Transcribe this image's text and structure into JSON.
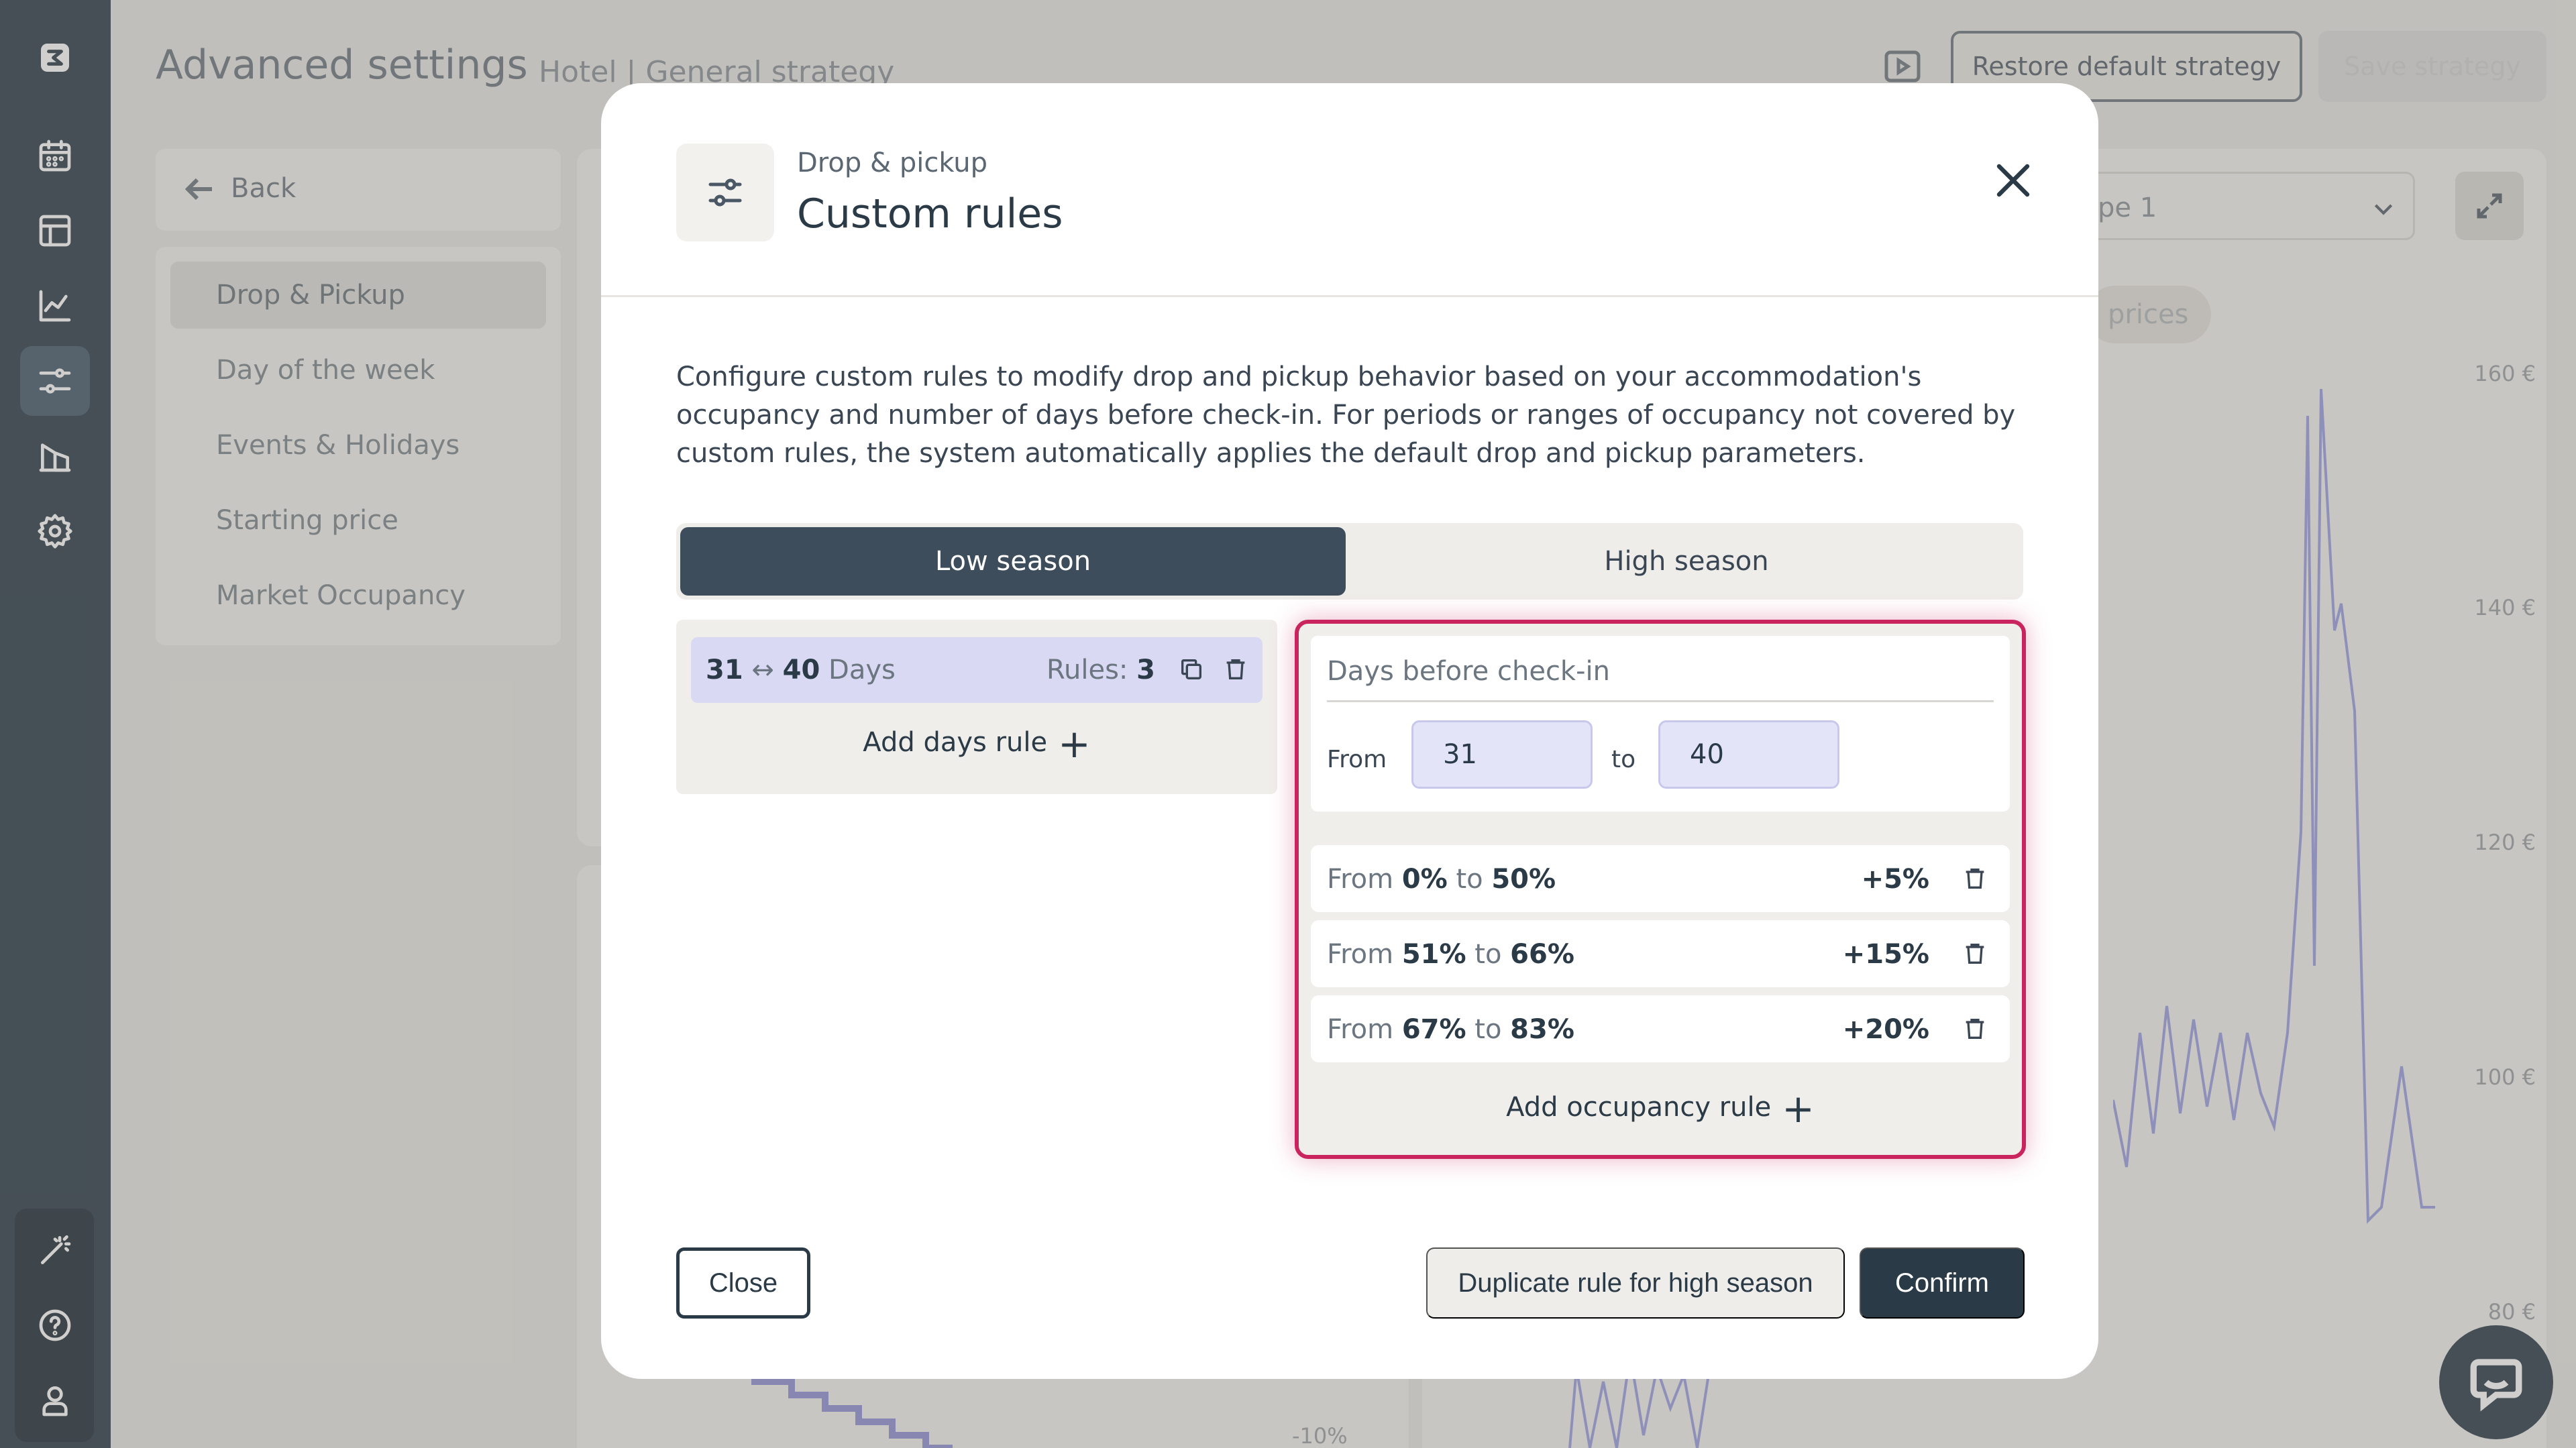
{
  "page": {
    "title": "Advanced settings",
    "subtitle": "Hotel | General strategy",
    "restore_label": "Restore default strategy",
    "save_label": "Save strategy"
  },
  "sidenav": {
    "back_label": "Back",
    "items": [
      {
        "label": "Drop & Pickup",
        "selected": true
      },
      {
        "label": "Day of the week",
        "selected": false
      },
      {
        "label": "Events & Holidays",
        "selected": false
      },
      {
        "label": "Starting price",
        "selected": false
      },
      {
        "label": "Market Occupancy",
        "selected": false
      }
    ]
  },
  "background": {
    "select_value": "pe 1",
    "pill_label": "prices",
    "y_ticks": [
      "160 €",
      "140 €",
      "120 €",
      "100 €",
      "80 €"
    ],
    "pct_label": "-10%"
  },
  "modal": {
    "kicker": "Drop & pickup",
    "title": "Custom rules",
    "description": "Configure custom rules to modify drop and pickup behavior based on your accommodation's occupancy and number of days before check-in. For periods or ranges of occupancy not covered by custom rules, the system automatically applies the default drop and pickup parameters.",
    "tabs": [
      {
        "label": "Low season",
        "active": true
      },
      {
        "label": "High season",
        "active": false
      }
    ],
    "days_rules": [
      {
        "from": "31",
        "arrow": "↔",
        "to": "40",
        "unit": "Days",
        "rules_label": "Rules:",
        "rules_count": "3"
      }
    ],
    "add_days_label": "Add days rule",
    "editor": {
      "days_label": "Days before check-in",
      "from_label": "From",
      "to_label": "to",
      "from_value": "31",
      "to_value": "40"
    },
    "occupancy_rules": [
      {
        "from_word": "From",
        "from": "0%",
        "to_word": "to",
        "to": "50%",
        "adjustment": "+5%"
      },
      {
        "from_word": "From",
        "from": "51%",
        "to_word": "to",
        "to": "66%",
        "adjustment": "+15%"
      },
      {
        "from_word": "From",
        "from": "67%",
        "to_word": "to",
        "to": "83%",
        "adjustment": "+20%"
      }
    ],
    "add_occupancy_label": "Add occupancy rule",
    "close_label": "Close",
    "duplicate_label": "Duplicate rule for high season",
    "confirm_label": "Confirm"
  },
  "colors": {
    "rail": "#2a3b48",
    "accent_highlight": "#c9245e",
    "primary_button": "#2b3a47",
    "days_row": "#d9d9f4",
    "chart_line": "#9c9ee0"
  },
  "icons": {
    "rail": [
      "logo-icon",
      "calendar-icon",
      "layout-icon",
      "chart-icon",
      "sliders-icon",
      "building-icon",
      "gear-icon",
      "magic-wand-icon",
      "help-icon",
      "user-icon"
    ]
  }
}
